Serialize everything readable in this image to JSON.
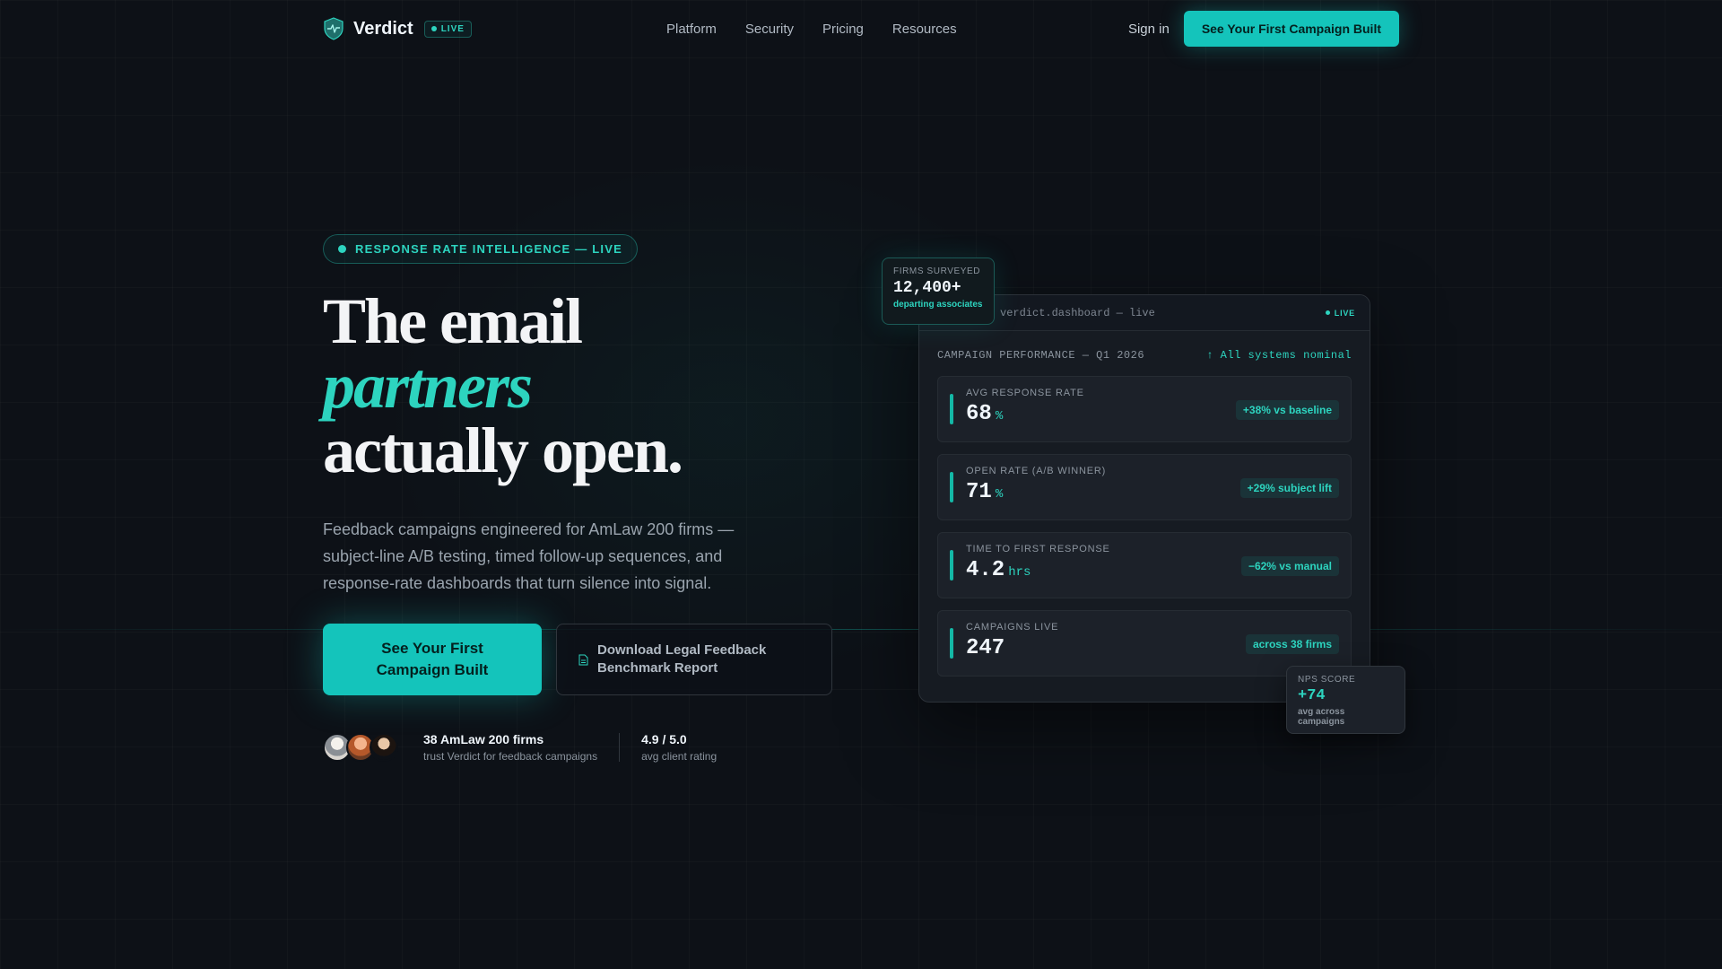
{
  "brand": {
    "name": "Verdict",
    "live_label": "LIVE"
  },
  "nav": {
    "links": [
      "Platform",
      "Security",
      "Pricing",
      "Resources"
    ],
    "signin": "Sign in",
    "cta": "See Your First Campaign Built"
  },
  "hero": {
    "eyebrow": "RESPONSE RATE INTELLIGENCE — LIVE",
    "headline_line1": "The email",
    "headline_accent": "partners",
    "headline_line3": "actually open.",
    "subtext": "Feedback campaigns engineered for AmLaw 200 firms — subject-line A/B testing, timed follow-up sequences, and response-rate dashboards that turn silence into signal.",
    "cta_primary": "See Your First Campaign Built",
    "cta_secondary": "Download Legal Feedback Benchmark Report"
  },
  "social_proof": {
    "firms_title": "38 AmLaw 200 firms",
    "firms_sub": "trust Verdict for feedback campaigns",
    "rating_title": "4.9 / 5.0",
    "rating_sub": "avg client rating"
  },
  "dashboard": {
    "window_title": "verdict.dashboard — live",
    "live_label": "LIVE",
    "header_label": "CAMPAIGN PERFORMANCE — Q1 2026",
    "status": "↑ All systems nominal",
    "metrics": [
      {
        "label": "AVG RESPONSE RATE",
        "value": "68",
        "unit": "%",
        "badge": "+38% vs baseline"
      },
      {
        "label": "OPEN RATE (A/B WINNER)",
        "value": "71",
        "unit": "%",
        "badge": "+29% subject lift"
      },
      {
        "label": "TIME TO FIRST RESPONSE",
        "value": "4.2",
        "unit": "hrs",
        "badge": "−62% vs manual"
      },
      {
        "label": "CAMPAIGNS LIVE",
        "value": "247",
        "unit": "",
        "badge": "across 38 firms"
      }
    ]
  },
  "firms_card": {
    "label": "FIRMS SURVEYED",
    "value": "12,400+",
    "sub": "departing associates"
  },
  "nps_card": {
    "label": "NPS SCORE",
    "value": "+74",
    "sub": "avg across campaigns"
  },
  "colors": {
    "accent": "#14c4bb",
    "accent_text": "#2dd4bf",
    "background": "#0d1117"
  },
  "icons": {
    "logo": "shield-logo-icon",
    "document": "document-icon"
  }
}
